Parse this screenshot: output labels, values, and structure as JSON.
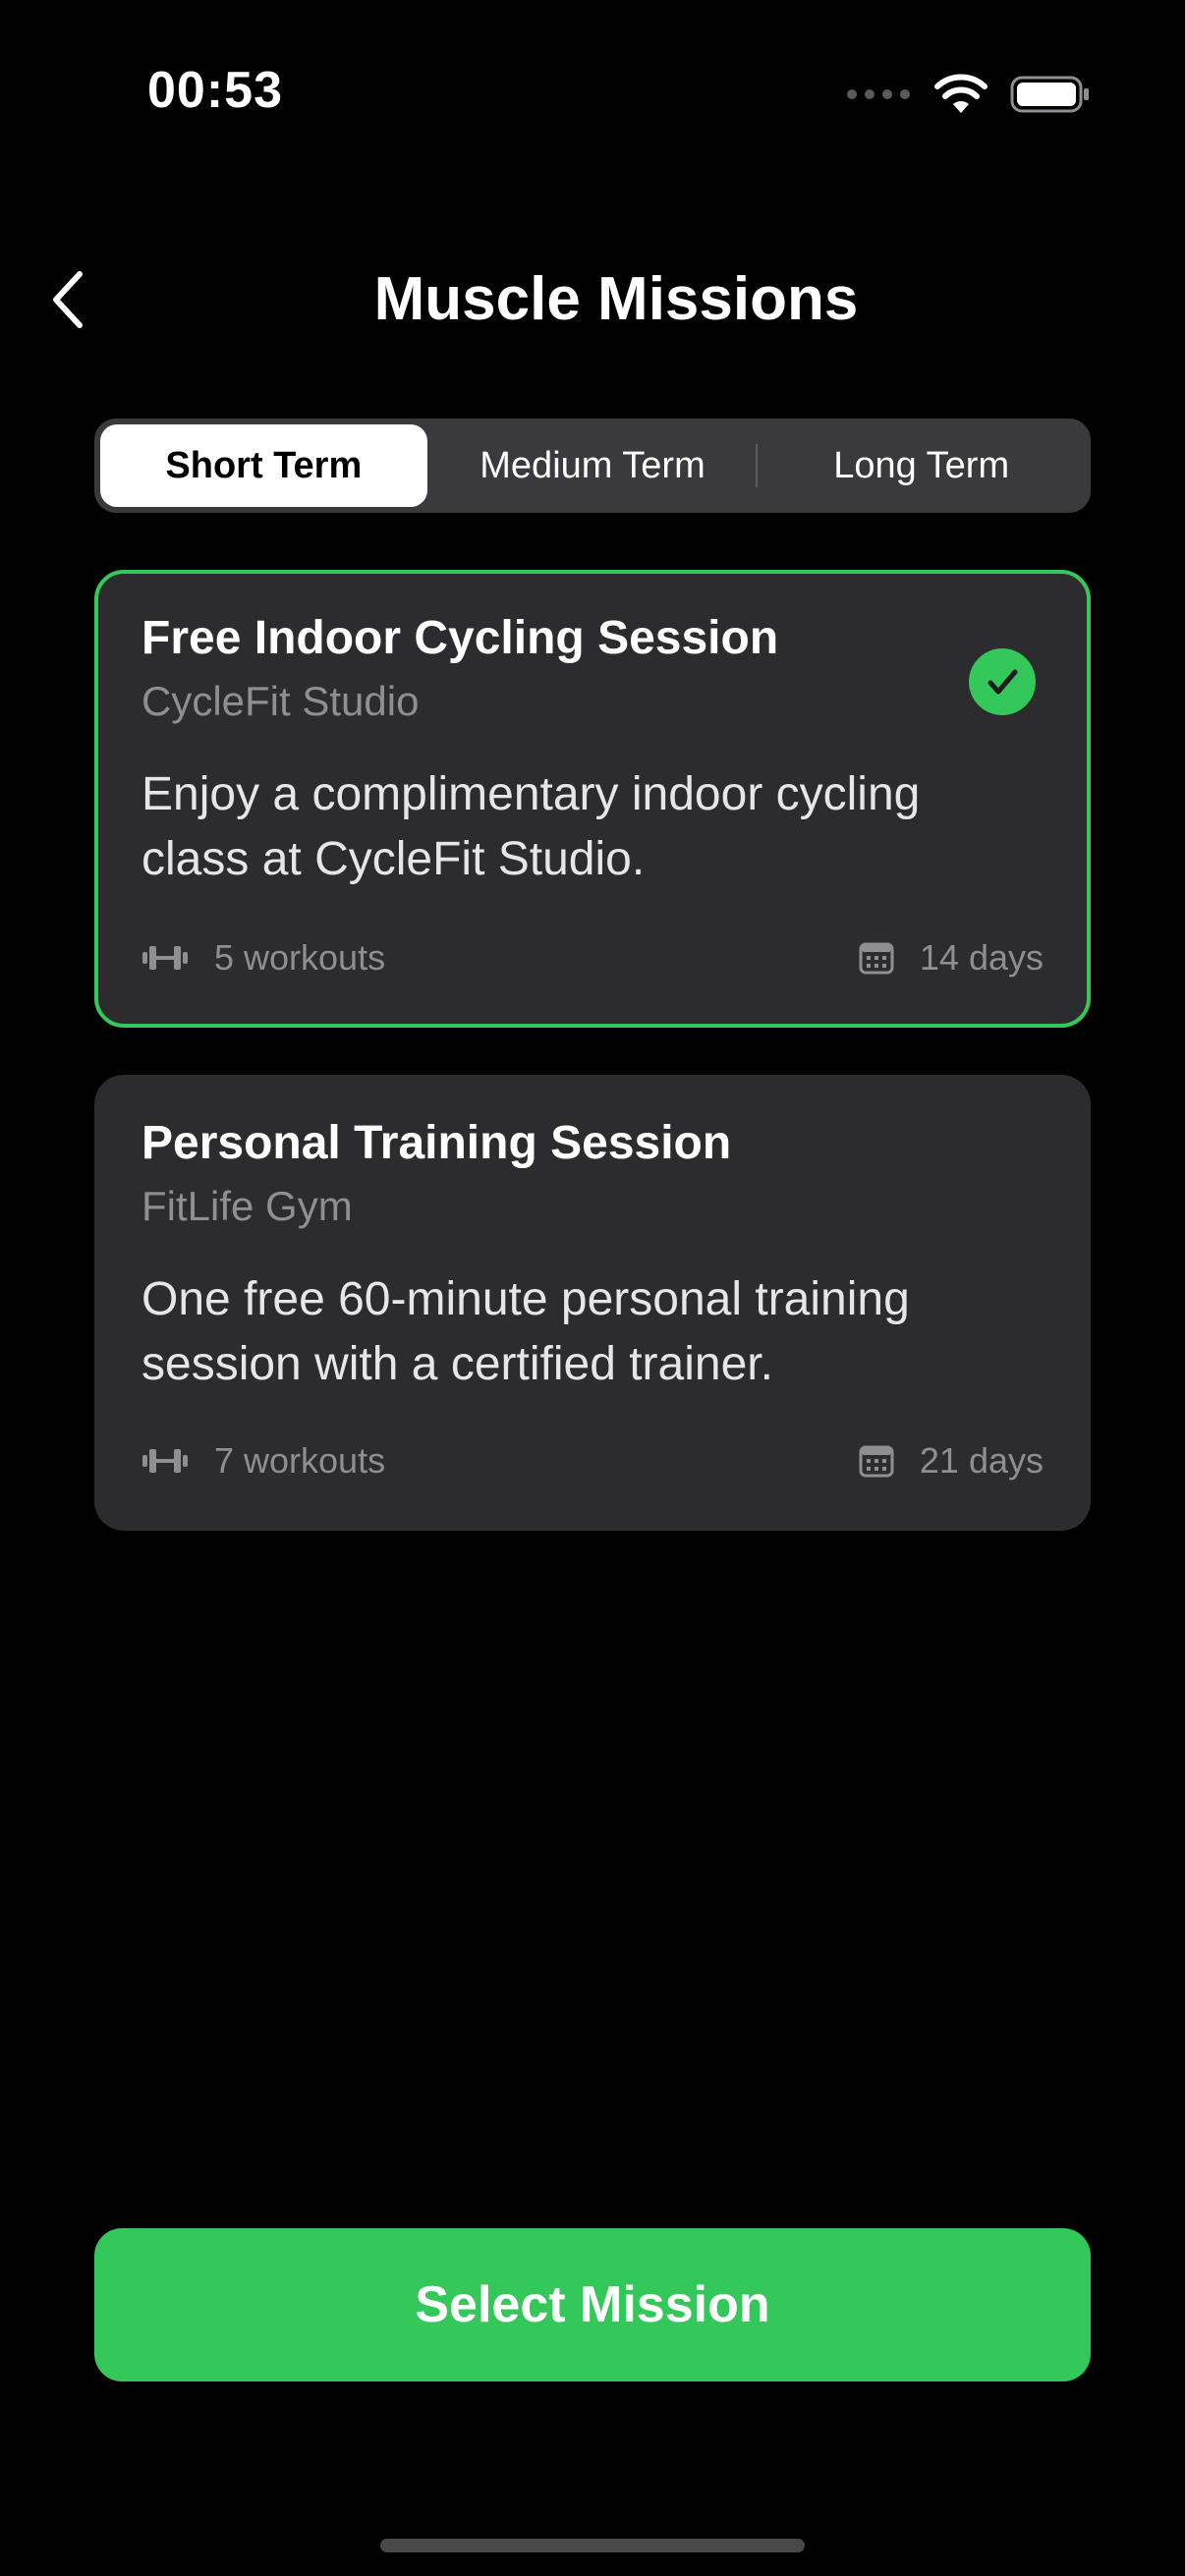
{
  "status_bar": {
    "time": "00:53",
    "icons": [
      "signal-dots-icon",
      "wifi-icon",
      "battery-icon"
    ]
  },
  "header": {
    "back_icon": "chevron-left-icon",
    "title": "Muscle Missions"
  },
  "tabs": [
    {
      "label": "Short Term",
      "selected": true
    },
    {
      "label": "Medium Term",
      "selected": false
    },
    {
      "label": "Long Term",
      "selected": false
    }
  ],
  "missions": [
    {
      "title": "Free Indoor Cycling Session",
      "provider": "CycleFit Studio",
      "description": "Enjoy a complimentary indoor cycling class at CycleFit Studio.",
      "workouts": "5 workouts",
      "duration": "14 days",
      "selected": true
    },
    {
      "title": "Personal Training Session",
      "provider": "FitLife Gym",
      "description": "One free 60-minute personal training session with a certified trainer.",
      "workouts": "7 workouts",
      "duration": "21 days",
      "selected": false
    }
  ],
  "actions": {
    "select_label": "Select Mission"
  },
  "colors": {
    "background": "#000000",
    "card": "#2c2c2e",
    "accent": "#34c759",
    "secondary_text": "#8e8e93",
    "segment_bg": "#3a3a3c"
  }
}
